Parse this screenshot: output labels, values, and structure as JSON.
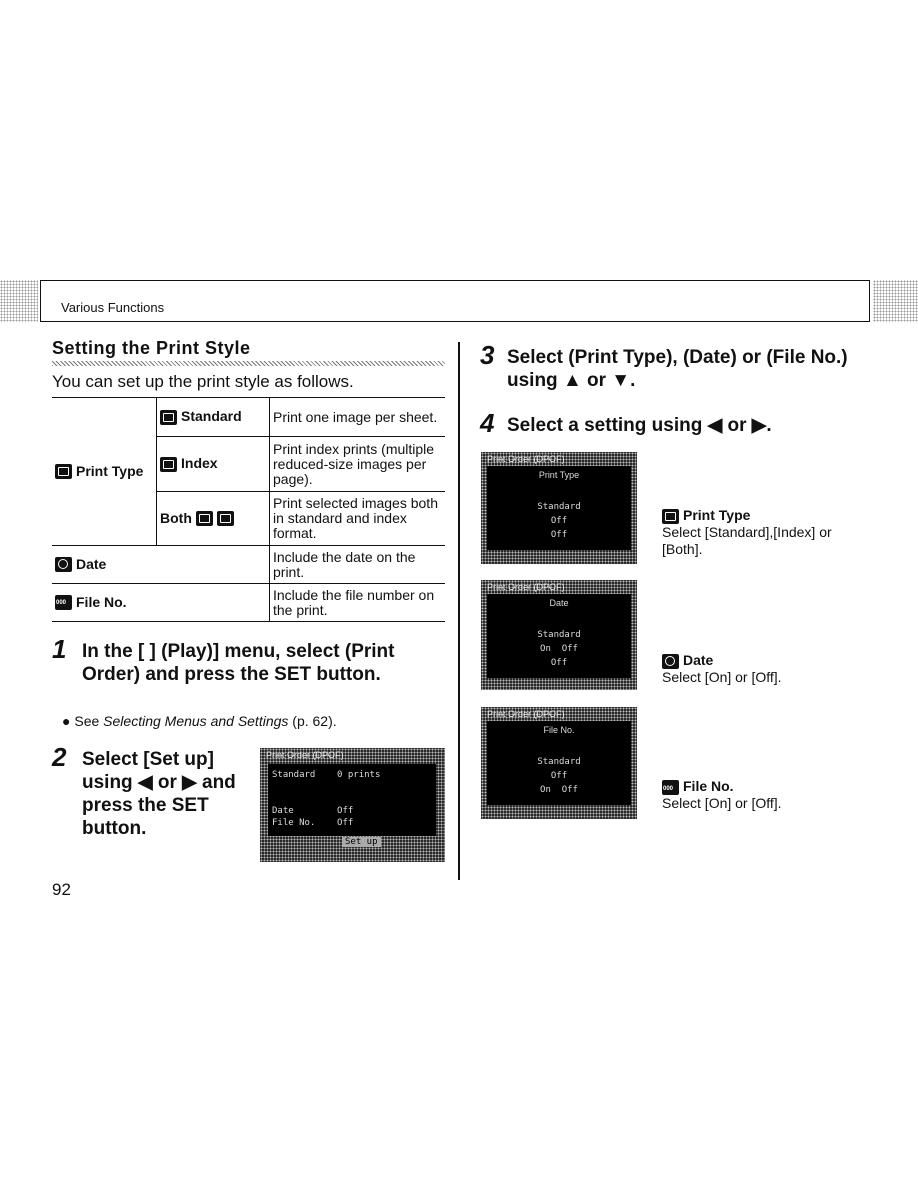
{
  "header": {
    "section": "Various Functions"
  },
  "left": {
    "title": "Setting the Print Style",
    "intro": "You can set up the print style as follows.",
    "table": {
      "print_type": "Print Type",
      "rows": [
        {
          "option": "Standard",
          "desc": "Print one image per sheet."
        },
        {
          "option": "Index",
          "desc": "Print index prints (multiple reduced-size images per page)."
        },
        {
          "option": "Both",
          "desc": "Print selected images both in standard and index format."
        }
      ],
      "date": {
        "label": "Date",
        "desc": "Include the date on the print."
      },
      "file_no": {
        "label": "File No.",
        "desc": "Include the file number on the print."
      }
    },
    "step1": {
      "num": "1",
      "text": "In the [ ] (Play)] menu, select  (Print Order) and press the SET button.",
      "bullet": "See ",
      "ref": "Selecting Menus and Settings",
      "page": " (p. 62)."
    },
    "step2": {
      "num": "2",
      "text": "Select [Set up] using ◀ or ▶ and press the SET button.",
      "screen": {
        "title": "Print Order (DPOF)",
        "lines": [
          "Standard    0 prints",
          "Date        Off",
          "File No.    Off"
        ],
        "button": "Set up"
      }
    },
    "page_number": "92"
  },
  "right": {
    "step3": {
      "num": "3",
      "text": "Select  (Print Type),  (Date) or  (File No.) using ▲ or ▼."
    },
    "step4": {
      "num": "4",
      "text": "Select a setting using ◀ or ▶."
    },
    "screens": [
      {
        "title": "Print Order (DPOF)",
        "heading": "Print Type",
        "lines": [
          "Standard",
          "Off",
          "Off"
        ],
        "caption_title": "Print Type",
        "caption": "Select [Standard],[Index] or [Both]."
      },
      {
        "title": "Print Order (DPOF)",
        "heading": "Date",
        "lines": [
          "Standard",
          "On  Off",
          "Off"
        ],
        "caption_title": "Date",
        "caption": "Select [On] or [Off]."
      },
      {
        "title": "Print Order (DPOF)",
        "heading": "File No.",
        "lines": [
          "Standard",
          "Off",
          "On  Off"
        ],
        "caption_title": "File No.",
        "caption": "Select [On] or [Off]."
      }
    ]
  }
}
